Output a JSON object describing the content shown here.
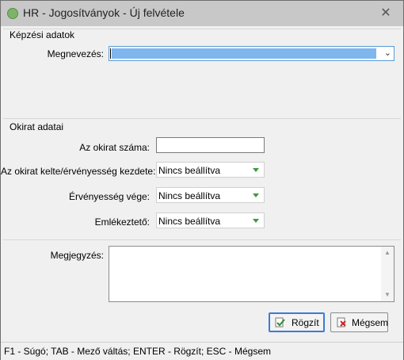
{
  "window": {
    "title": "HR - Jogosítványok - Új felvétele"
  },
  "sections": {
    "kepzesi": {
      "title": "Képzési adatok",
      "megnevezes_label": "Megnevezés:",
      "megnevezes_value": ""
    },
    "okirat": {
      "title": "Okirat adatai",
      "szam_label": "Az okirat száma:",
      "szam_value": "",
      "kelte_label": "Az okirat kelte/érvényesség kezdete:",
      "kelte_value": "Nincs beállítva",
      "vege_label": "Érvényesség vége:",
      "vege_value": "Nincs beállítva",
      "emlekezteto_label": "Emlékeztető:",
      "emlekezteto_value": "Nincs beállítva"
    },
    "megjegyzes": {
      "label": "Megjegyzés:",
      "value": ""
    }
  },
  "buttons": {
    "save": "Rögzít",
    "cancel": "Mégsem"
  },
  "statusbar": "F1 - Súgó; TAB - Mező váltás; ENTER - Rögzít; ESC - Mégsem",
  "icons": {
    "app": "app-icon",
    "close": "close-icon",
    "save": "check-document-icon",
    "cancel": "cancel-document-icon"
  },
  "colors": {
    "selection": "#7eb6ed",
    "focus_border": "#5b9bd5",
    "dropdown_arrow": "#3c9a3c"
  }
}
